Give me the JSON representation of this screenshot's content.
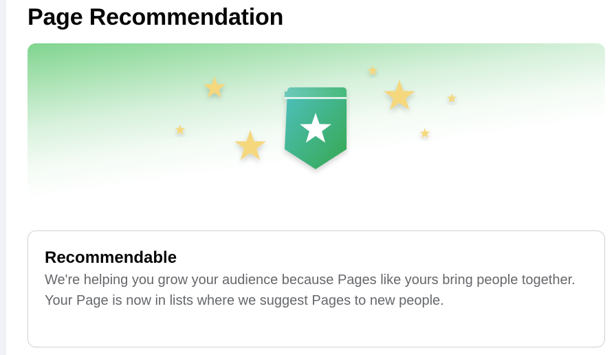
{
  "page": {
    "title": "Page Recommendation"
  },
  "banner": {
    "illustration": "star-badge-icon",
    "colors": {
      "gradient_top": "#7fd48f",
      "badge_top": "#5cc4b4",
      "badge_bottom": "#35a852",
      "star": "#f5d77e"
    }
  },
  "status_card": {
    "title": "Recommendable",
    "description": "We're helping you grow your audience because Pages like yours bring people together. Your Page is now in lists where we suggest Pages to new people."
  }
}
